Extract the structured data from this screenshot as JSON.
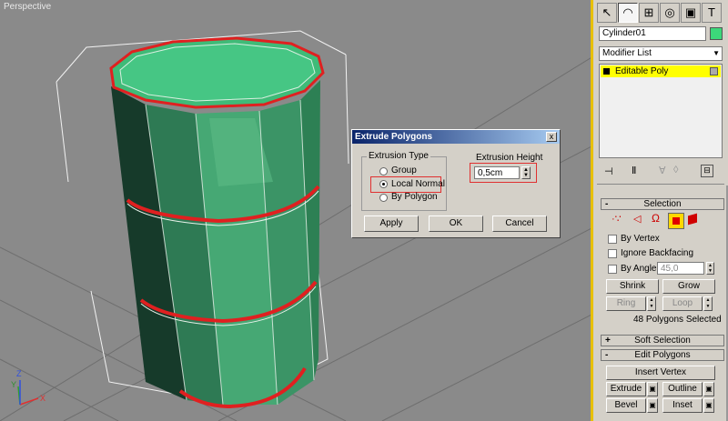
{
  "viewport": {
    "label": "Perspective",
    "axes": {
      "x": "X",
      "y": "Y",
      "z": "Z"
    }
  },
  "dialog": {
    "title": "Extrude Polygons",
    "close_label": "x",
    "extrusion_type": {
      "label": "Extrusion Type",
      "options": [
        "Group",
        "Local Normal",
        "By Polygon"
      ],
      "selected": "Local Normal"
    },
    "extrusion_height": {
      "label": "Extrusion Height",
      "value": "0,5cm"
    },
    "buttons": {
      "apply": "Apply",
      "ok": "OK",
      "cancel": "Cancel"
    }
  },
  "panel": {
    "object_name": "Cylinder01",
    "object_color": "#3cd87a",
    "modifier_list": "Modifier List",
    "stack_item": "Editable Poly",
    "selection": {
      "title": "Selection",
      "by_vertex": "By Vertex",
      "ignore_backfacing": "Ignore Backfacing",
      "by_angle": "By Angle:",
      "angle_value": "45,0",
      "shrink": "Shrink",
      "grow": "Grow",
      "ring": "Ring",
      "loop": "Loop",
      "status": "48 Polygons Selected"
    },
    "soft_selection": {
      "title": "Soft Selection"
    },
    "edit_polygons": {
      "title": "Edit Polygons",
      "insert_vertex": "Insert Vertex",
      "extrude": "Extrude",
      "outline": "Outline",
      "bevel": "Bevel",
      "inset": "Inset"
    }
  }
}
